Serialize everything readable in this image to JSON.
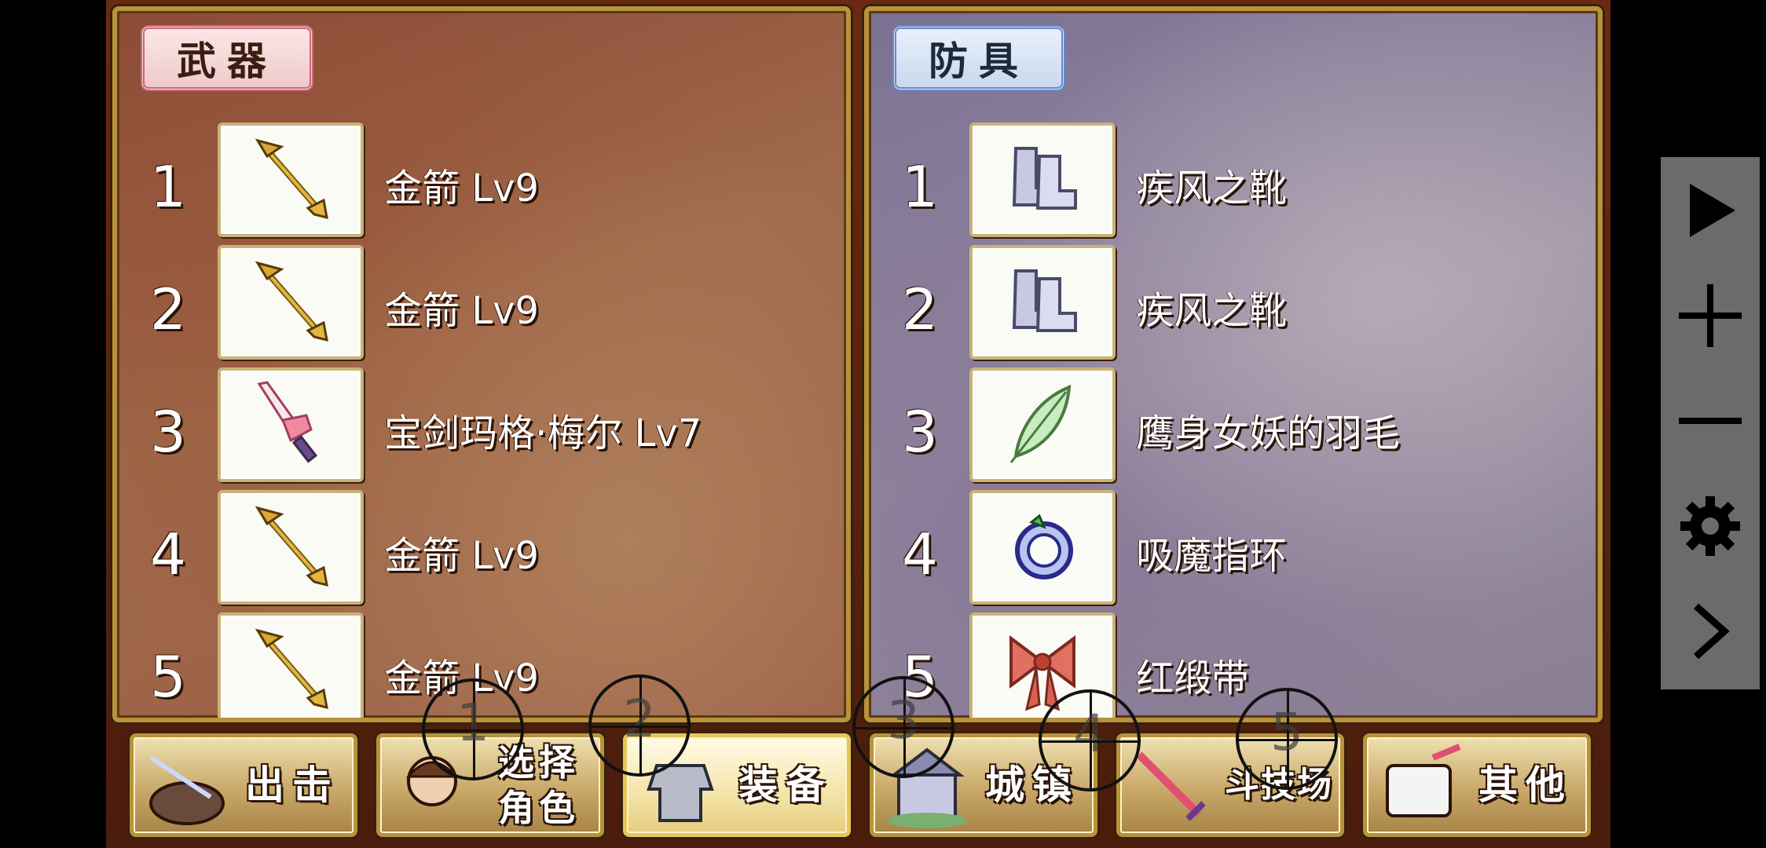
{
  "weapons": {
    "title": "武器",
    "slots": [
      {
        "num": "1",
        "name": "金箭 Lv9",
        "icon": "golden-arrow-icon"
      },
      {
        "num": "2",
        "name": "金箭 Lv9",
        "icon": "golden-arrow-icon"
      },
      {
        "num": "3",
        "name": "宝剑玛格·梅尔 Lv7",
        "icon": "pink-sword-icon"
      },
      {
        "num": "4",
        "name": "金箭 Lv9",
        "icon": "golden-arrow-icon"
      },
      {
        "num": "5",
        "name": "金箭 Lv9",
        "icon": "golden-arrow-icon"
      }
    ]
  },
  "armor": {
    "title": "防具",
    "slots": [
      {
        "num": "1",
        "name": "疾风之靴",
        "icon": "boots-icon"
      },
      {
        "num": "2",
        "name": "疾风之靴",
        "icon": "boots-icon"
      },
      {
        "num": "3",
        "name": "鹰身女妖的羽毛",
        "icon": "feather-icon"
      },
      {
        "num": "4",
        "name": "吸魔指环",
        "icon": "ring-icon"
      },
      {
        "num": "5",
        "name": "红缎带",
        "icon": "red-ribbon-icon"
      }
    ]
  },
  "tabs": [
    {
      "label": "出击",
      "icon": "sortie-icon",
      "active": false
    },
    {
      "label": "选择\n角色",
      "icon": "character-icon",
      "active": false
    },
    {
      "label": "装备",
      "icon": "armor-icon",
      "active": true
    },
    {
      "label": "城镇",
      "icon": "town-icon",
      "active": false
    },
    {
      "label": "斗技场",
      "icon": "sword-icon",
      "active": false
    },
    {
      "label": "其他",
      "icon": "scroll-icon",
      "active": false
    }
  ],
  "overlay_markers": [
    "1",
    "2",
    "3",
    "4",
    "5"
  ],
  "sidebar": [
    {
      "name": "play-icon"
    },
    {
      "name": "plus-icon"
    },
    {
      "name": "minus-icon"
    },
    {
      "name": "gear-icon"
    },
    {
      "name": "chevron-right-icon"
    }
  ],
  "colors": {
    "panel_border": "#b8923c",
    "weapons_title_border": "#c86a78",
    "armor_title_border": "#6a88c8",
    "sidebar_bg": "#6b6b6b",
    "active_tab": "#f4e4a8"
  }
}
